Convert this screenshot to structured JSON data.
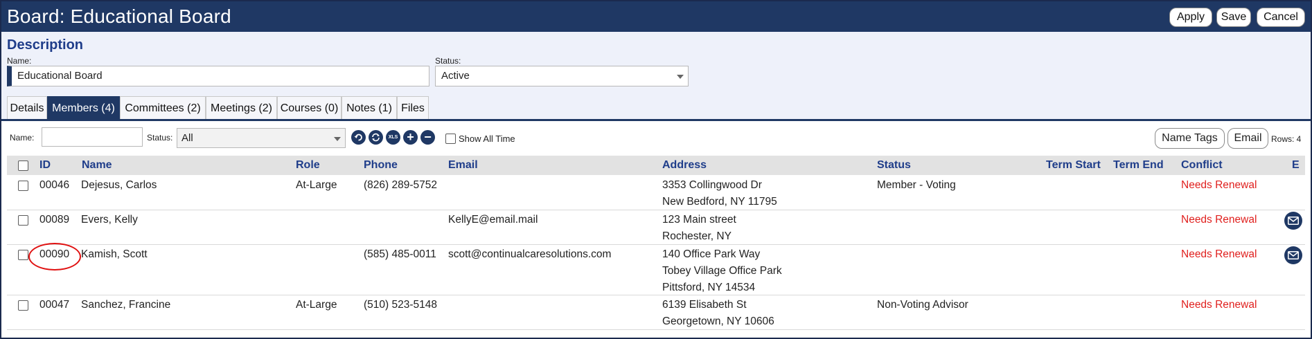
{
  "header": {
    "title": "Board: Educational Board",
    "apply": "Apply",
    "save": "Save",
    "cancel": "Cancel"
  },
  "description": {
    "section_title": "Description",
    "name_label": "Name:",
    "name_value": "Educational Board",
    "status_label": "Status:",
    "status_value": "Active"
  },
  "tabs": [
    {
      "label": "Details"
    },
    {
      "label": "Members (4)",
      "active": true
    },
    {
      "label": "Committees (2)"
    },
    {
      "label": "Meetings (2)"
    },
    {
      "label": "Courses (0)"
    },
    {
      "label": "Notes (1)"
    },
    {
      "label": "Files"
    }
  ],
  "toolbar": {
    "name_label": "Name:",
    "status_label": "Status:",
    "status_value": "All",
    "xls_label": "XLS",
    "show_all_time": "Show All Time",
    "name_tags": "Name Tags",
    "email": "Email",
    "rows_count": "Rows: 4"
  },
  "table": {
    "columns": {
      "id": "ID",
      "name": "Name",
      "role": "Role",
      "phone": "Phone",
      "email": "Email",
      "address": "Address",
      "status": "Status",
      "term_start": "Term Start",
      "term_end": "Term End",
      "conflict": "Conflict",
      "e": "E"
    },
    "rows": [
      {
        "id": "00046",
        "name": "Dejesus, Carlos",
        "role": "At-Large",
        "phone": "(826) 289-5752",
        "email": "",
        "address1": "3353 Collingwood Dr",
        "address2": "New Bedford, NY 11795",
        "address3": "",
        "status": "Member - Voting",
        "conflict": "Needs Renewal",
        "has_email_icon": false
      },
      {
        "id": "00089",
        "name": "Evers, Kelly",
        "role": "",
        "phone": "",
        "email": "KellyE@email.mail",
        "address1": "123 Main street",
        "address2": "Rochester, NY",
        "address3": "",
        "status": "",
        "conflict": "Needs Renewal",
        "has_email_icon": true
      },
      {
        "id": "00090",
        "name": "Kamish, Scott",
        "role": "",
        "phone": "(585) 485-0011",
        "email": "scott@continualcaresolutions.com",
        "address1": "140 Office Park Way",
        "address2": "Tobey Village Office Park",
        "address3": "Pittsford, NY 14534",
        "status": "",
        "conflict": "Needs Renewal",
        "has_email_icon": true
      },
      {
        "id": "00047",
        "name": "Sanchez, Francine",
        "role": "At-Large",
        "phone": "(510) 523-5148",
        "email": "",
        "address1": "6139 Elisabeth St",
        "address2": "Georgetown, NY 10606",
        "address3": "",
        "status": "Non-Voting Advisor",
        "conflict": "Needs Renewal",
        "has_email_icon": false
      }
    ]
  },
  "colors": {
    "navy": "#1f3864",
    "header_text": "#1f3d8a",
    "alert_red": "#e0201e",
    "annotation_red": "#e01010"
  }
}
